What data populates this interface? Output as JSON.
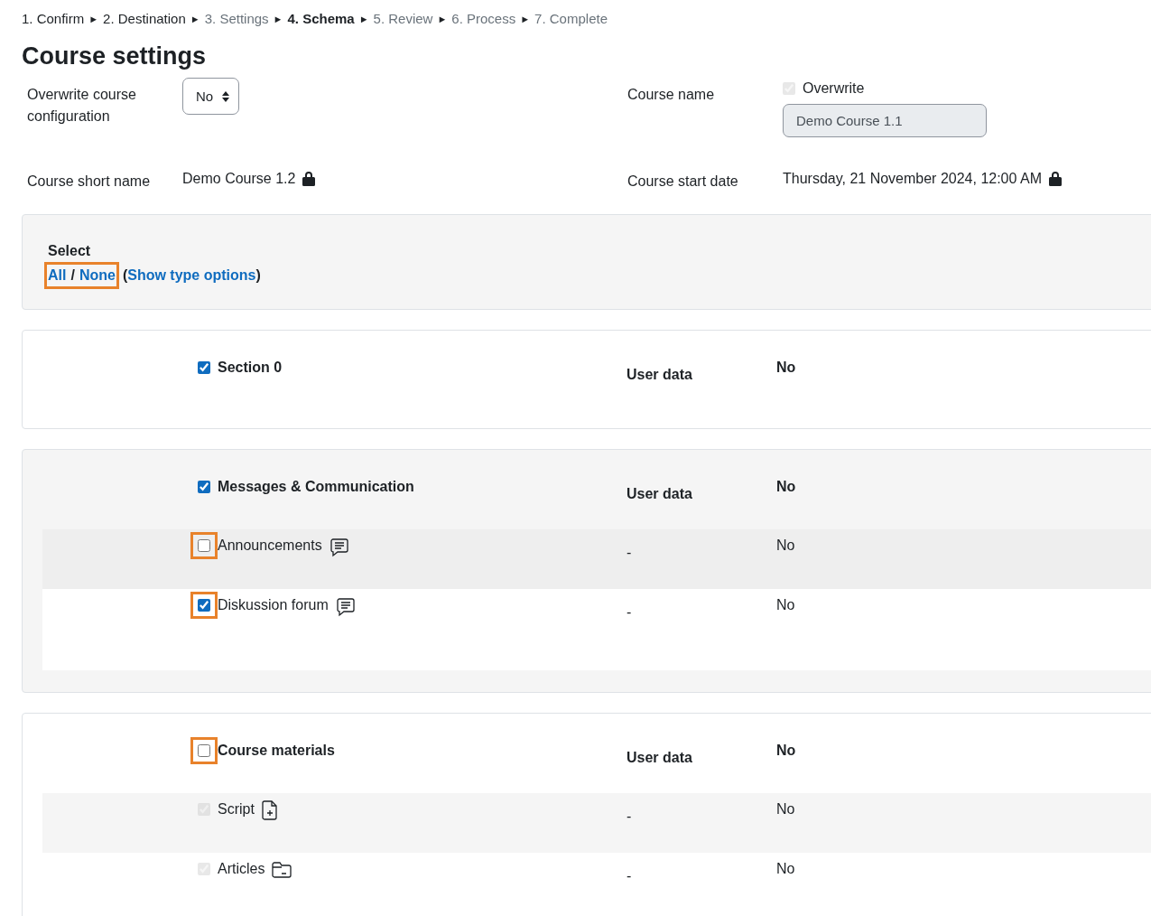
{
  "steps": [
    {
      "label": "1. Confirm",
      "selected": false,
      "disabled": false
    },
    {
      "label": "2. Destination",
      "selected": false,
      "disabled": false
    },
    {
      "label": "3. Settings",
      "selected": false,
      "disabled": true
    },
    {
      "label": "4. Schema",
      "selected": true,
      "disabled": false
    },
    {
      "label": "5. Review",
      "selected": false,
      "disabled": true
    },
    {
      "label": "6. Process",
      "selected": false,
      "disabled": true
    },
    {
      "label": "7. Complete",
      "selected": false,
      "disabled": true
    }
  ],
  "separator": "►",
  "title": "Course settings",
  "settings": {
    "overwrite_label": "Overwrite course configuration",
    "overwrite_value": "No",
    "short_name_label": "Course short name",
    "short_name_value": "Demo Course 1.2",
    "course_name_label": "Course name",
    "overwrite_checkbox": {
      "label": "Overwrite",
      "checked": true,
      "disabled": true
    },
    "course_name_value": "Demo Course 1.1",
    "start_date_label": "Course start date",
    "start_date_value": "Thursday, 21 November 2024, 12:00 AM"
  },
  "select": {
    "label": "Select",
    "all": "All",
    "slash": "/",
    "none": "None",
    "highlighted": true,
    "open_paren": "(",
    "type_options": "Show type options",
    "close_paren": ")"
  },
  "sections": [
    {
      "title": "Section 0",
      "checked": true,
      "highlighted": false,
      "shaded": false,
      "user_data_label": "User data",
      "user_data_value": "No"
    },
    {
      "title": "Messages & Communication",
      "checked": true,
      "highlighted": false,
      "shaded": true,
      "user_data_label": "User data",
      "user_data_value": "No",
      "items": [
        {
          "label": "Announcements",
          "kind": "forum",
          "checked": false,
          "disabled": false,
          "highlighted": true,
          "user_data": "-",
          "value": "No"
        },
        {
          "label": "Diskussion forum",
          "kind": "forum",
          "checked": true,
          "disabled": false,
          "highlighted": true,
          "user_data": "-",
          "value": "No"
        }
      ]
    },
    {
      "title": "Course materials",
      "checked": false,
      "highlighted": true,
      "shaded": false,
      "user_data_label": "User data",
      "user_data_value": "No",
      "items": [
        {
          "label": "Script",
          "kind": "file",
          "checked": true,
          "disabled": true,
          "user_data": "-",
          "value": "No"
        },
        {
          "label": "Articles",
          "kind": "folder",
          "checked": true,
          "disabled": true,
          "user_data": "-",
          "value": "No"
        }
      ]
    }
  ]
}
